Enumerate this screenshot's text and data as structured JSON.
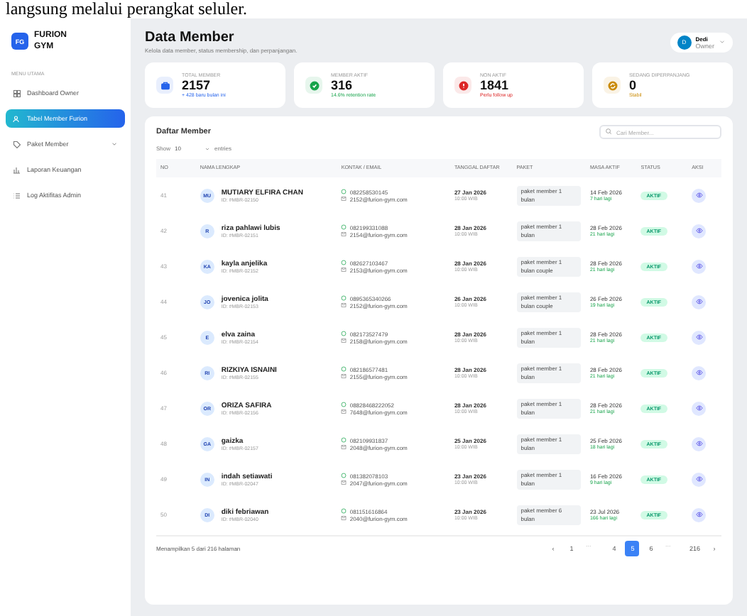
{
  "document_text": "langsung melalui perangkat seluler.",
  "brand": {
    "logo": "FG",
    "name": "FURION GYM"
  },
  "sidebar": {
    "section": "MENU UTAMA",
    "items": [
      {
        "label": "Dashboard Owner",
        "selected": false,
        "expandable": false
      },
      {
        "label": "Tabel Member Furion",
        "selected": true,
        "expandable": false
      },
      {
        "label": "Paket Member",
        "selected": false,
        "expandable": true
      },
      {
        "label": "Laporan Keuangan",
        "selected": false,
        "expandable": false
      },
      {
        "label": "Log Aktifitas Admin",
        "selected": false,
        "expandable": false
      }
    ]
  },
  "header": {
    "title": "Data Member",
    "subtitle": "Kelola data member, status membership, dan perpanjangan.",
    "user": {
      "initials": "D",
      "name": "Dedi",
      "role": "Owner"
    }
  },
  "stats": [
    {
      "label": "TOTAL MEMBER",
      "value": "2157",
      "note": "+ 428 baru bulan ini",
      "color": "#2563eb"
    },
    {
      "label": "MEMBER AKTIF",
      "value": "316",
      "note": "14.6% retention rate",
      "color": "#16a34a"
    },
    {
      "label": "NON AKTIF",
      "value": "1841",
      "note": "Perlu follow up",
      "color": "#dc2626"
    },
    {
      "label": "SEDANG DIPERPANJANG",
      "value": "0",
      "note": "Stabil",
      "color": "#ca8a04"
    }
  ],
  "table": {
    "title": "Daftar Member",
    "search_placeholder": "Cari Member...",
    "show_label": "Show",
    "page_size": "10",
    "entries_label": "entries",
    "columns": [
      "NO",
      "NAMA LENGKAP",
      "KONTAK / EMAIL",
      "TANGGAL DAFTAR",
      "PAKET",
      "MASA AKTIF",
      "STATUS",
      "AKSI"
    ],
    "rows": [
      {
        "no": "41",
        "initials": "MU",
        "name": "MUTIARY ELFIRA CHAN",
        "id": "ID: #MBR-02150",
        "phone": "082258530145",
        "email": "2152@furion-gym.com",
        "date": "27 Jan 2026",
        "time": "10:00 WIB",
        "paket": "paket member 1 bulan",
        "masa": "14 Feb 2026",
        "remaining": "7 hari lagi",
        "status": "AKTIF"
      },
      {
        "no": "42",
        "initials": "R",
        "name": "riza pahlawi lubis",
        "id": "ID: #MBR-02151",
        "phone": "082199331088",
        "email": "2154@furion-gym.com",
        "date": "28 Jan 2026",
        "time": "10:00 WIB",
        "paket": "paket member 1 bulan",
        "masa": "28 Feb 2026",
        "remaining": "21 hari lagi",
        "status": "AKTIF"
      },
      {
        "no": "43",
        "initials": "KA",
        "name": "kayla anjelika",
        "id": "ID: #MBR-02152",
        "phone": "082627103467",
        "email": "2153@furion-gym.com",
        "date": "28 Jan 2026",
        "time": "10:00 WIB",
        "paket": "paket member 1 bulan couple",
        "masa": "28 Feb 2026",
        "remaining": "21 hari lagi",
        "status": "AKTIF"
      },
      {
        "no": "44",
        "initials": "JO",
        "name": "jovenica jolita",
        "id": "ID: #MBR-02153",
        "phone": "0895365340266",
        "email": "2152@furion-gym.com",
        "date": "26 Jan 2026",
        "time": "10:00 WIB",
        "paket": "paket member 1 bulan couple",
        "masa": "26 Feb 2026",
        "remaining": "19 hari lagi",
        "status": "AKTIF"
      },
      {
        "no": "45",
        "initials": "E",
        "name": "elva zaina",
        "id": "ID: #MBR-02154",
        "phone": "082173527479",
        "email": "2158@furion-gym.com",
        "date": "28 Jan 2026",
        "time": "10:00 WIB",
        "paket": "paket member 1 bulan",
        "masa": "28 Feb 2026",
        "remaining": "21 hari lagi",
        "status": "AKTIF"
      },
      {
        "no": "46",
        "initials": "RI",
        "name": "RIZKIYA ISNAINI",
        "id": "ID: #MBR-02155",
        "phone": "082186577481",
        "email": "2155@furion-gym.com",
        "date": "28 Jan 2026",
        "time": "10:00 WIB",
        "paket": "paket member 1 bulan",
        "masa": "28 Feb 2026",
        "remaining": "21 hari lagi",
        "status": "AKTIF"
      },
      {
        "no": "47",
        "initials": "OR",
        "name": "ORIZA SAFIRA",
        "id": "ID: #MBR-02156",
        "phone": "08828468222052",
        "email": "7648@furion-gym.com",
        "date": "28 Jan 2026",
        "time": "10:00 WIB",
        "paket": "paket member 1 bulan",
        "masa": "28 Feb 2026",
        "remaining": "21 hari lagi",
        "status": "AKTIF"
      },
      {
        "no": "48",
        "initials": "GA",
        "name": "gaizka",
        "id": "ID: #MBR-02157",
        "phone": "082109931837",
        "email": "2048@furion-gym.com",
        "date": "25 Jan 2026",
        "time": "10:00 WIB",
        "paket": "paket member 1 bulan",
        "masa": "25 Feb 2026",
        "remaining": "18 hari lagi",
        "status": "AKTIF"
      },
      {
        "no": "49",
        "initials": "IN",
        "name": "indah setiawati",
        "id": "ID: #MBR-02047",
        "phone": "081382078103",
        "email": "2047@furion-gym.com",
        "date": "23 Jan 2026",
        "time": "10:00 WIB",
        "paket": "paket member 1 bulan",
        "masa": "16 Feb 2026",
        "remaining": "9 hari lagi",
        "status": "AKTIF"
      },
      {
        "no": "50",
        "initials": "DI",
        "name": "diki febriawan",
        "id": "ID: #MBR-02040",
        "phone": "081151616864",
        "email": "2040@furion-gym.com",
        "date": "23 Jan 2026",
        "time": "10:00 WIB",
        "paket": "paket member 6 bulan",
        "masa": "23 Jul 2026",
        "remaining": "166 hari lagi",
        "status": "AKTIF"
      }
    ],
    "footer": "Menampilkan 5 dari 216 halaman",
    "pagination": [
      {
        "label": "‹",
        "kind": "arrow",
        "selected": false
      },
      {
        "label": "1",
        "kind": "page",
        "selected": false
      },
      {
        "label": "...",
        "kind": "gap",
        "selected": false
      },
      {
        "label": "4",
        "kind": "page",
        "selected": false
      },
      {
        "label": "5",
        "kind": "page",
        "selected": true
      },
      {
        "label": "6",
        "kind": "page",
        "selected": false
      },
      {
        "label": "...",
        "kind": "gap",
        "selected": false
      },
      {
        "label": "216",
        "kind": "page",
        "selected": false
      },
      {
        "label": "›",
        "kind": "arrow",
        "selected": false
      }
    ]
  }
}
